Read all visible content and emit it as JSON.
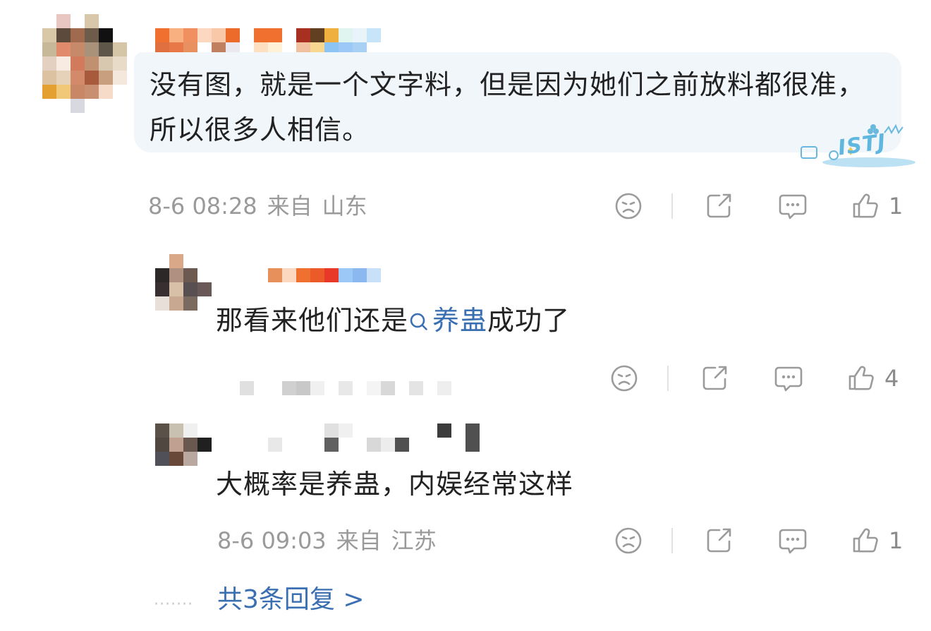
{
  "comment": {
    "text": "没有图，就是一个文字料，但是因为她们之前放料都很准，所以很多人相信。",
    "date": "8-6 08:28",
    "from_label": "来自",
    "location": "山东",
    "like_count": "1",
    "badge": "ISTJ"
  },
  "replies": [
    {
      "text_before": "那看来他们还是",
      "topic": "养蛊",
      "text_after": "成功了",
      "date": "",
      "from_label": "",
      "location": "",
      "like_count": "4"
    },
    {
      "text": "大概率是养蛊，内娱经常这样",
      "date": "8-6 09:03",
      "from_label": "来自",
      "location": "江苏",
      "like_count": "1"
    }
  ],
  "more_replies_label": "共3条回复 >",
  "dots": "·······",
  "icons": [
    "dislike-icon",
    "share-icon",
    "comment-icon",
    "like-icon",
    "search-icon"
  ],
  "colors": {
    "link": "#3a6fb2",
    "meta": "#9a9a9a",
    "bubble": "#f1f6fb",
    "icon": "#9b9b9b"
  }
}
